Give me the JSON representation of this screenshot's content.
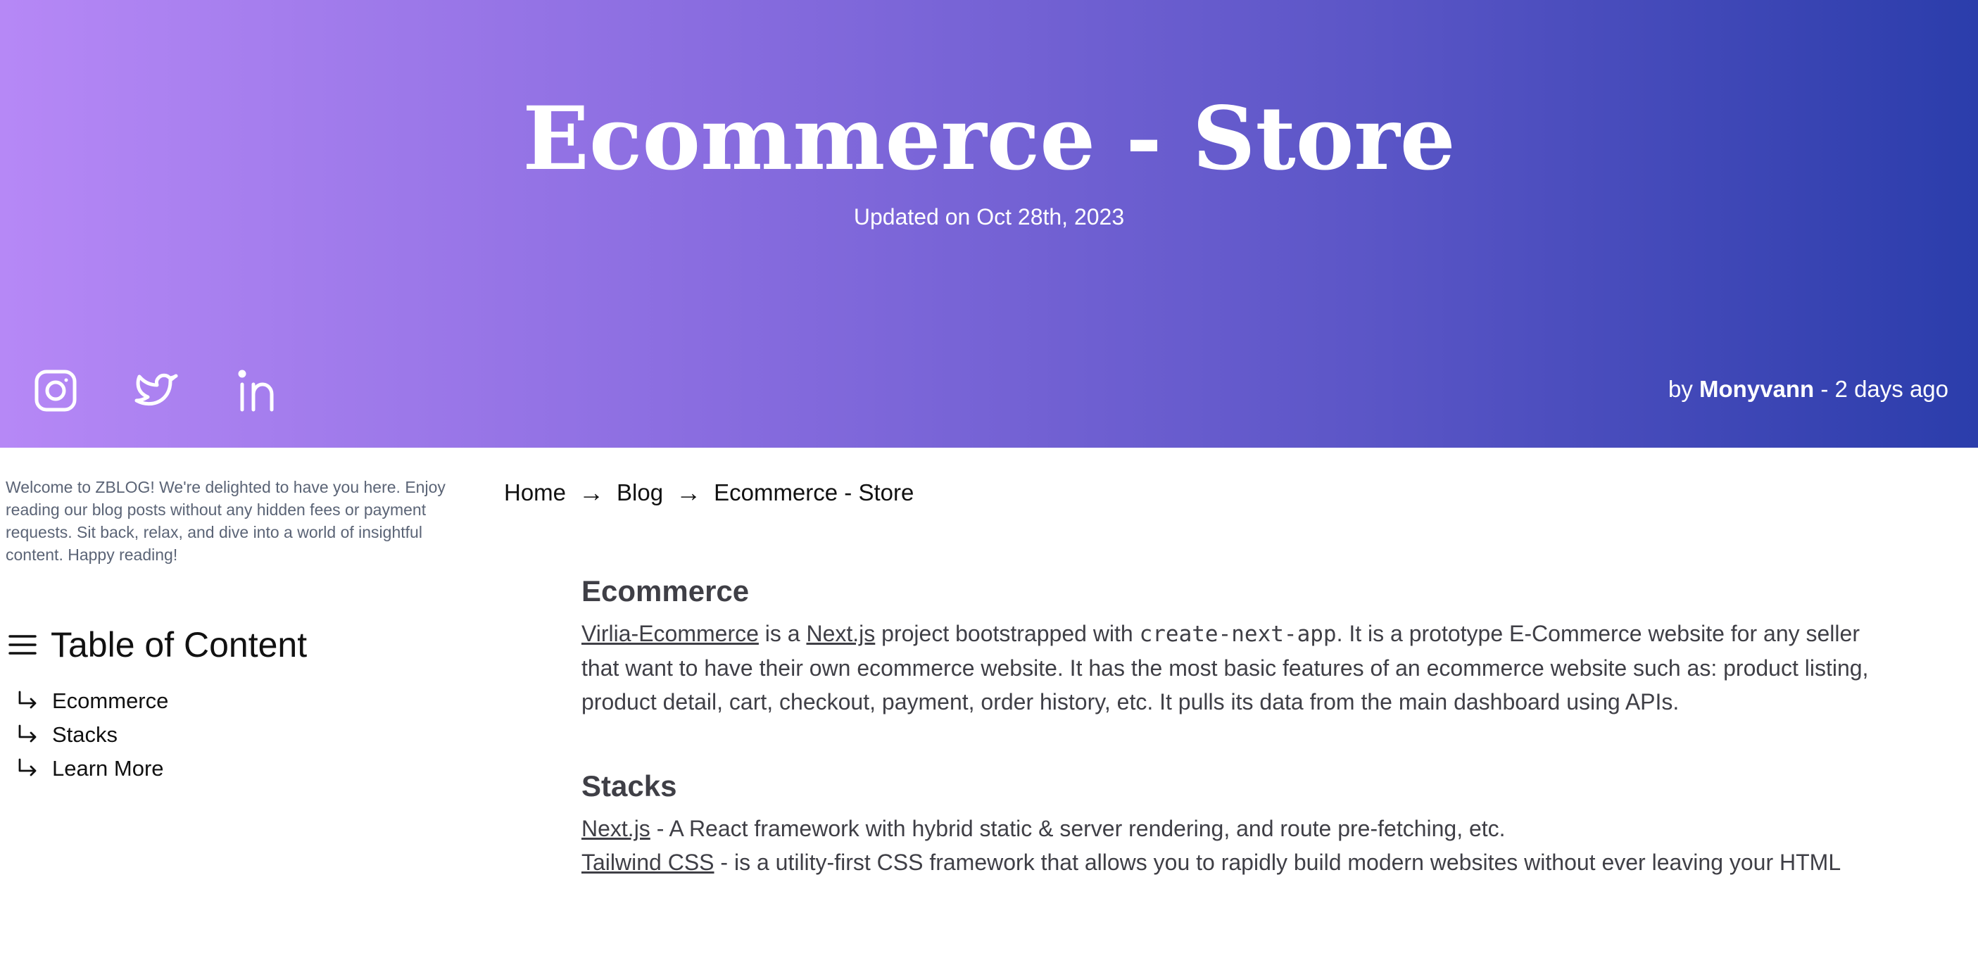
{
  "hero": {
    "title": "Ecommerce - Store",
    "updated": "Updated on Oct 28th, 2023",
    "social": [
      "instagram-icon",
      "twitter-icon",
      "linkedin-icon"
    ],
    "byline_prefix": "by ",
    "author": "Monyvann",
    "byline_suffix": " - 2 days ago",
    "gradient": [
      "#b688f6",
      "#2b3dab"
    ]
  },
  "sidebar": {
    "welcome": "Welcome to ZBLOG! We're delighted to have you here. Enjoy reading our blog posts without any hidden fees or payment requests. Sit back, relax, and dive into a world of insightful content. Happy reading!",
    "toc_title": "Table of Content",
    "toc_items": [
      "Ecommerce",
      "Stacks",
      "Learn More"
    ]
  },
  "breadcrumb": {
    "items": [
      "Home",
      "Blog",
      "Ecommerce - Store"
    ],
    "separator": "→"
  },
  "article": {
    "sections": [
      {
        "heading": "Ecommerce",
        "link1": "Virlia-Ecommerce",
        "text1": " is a ",
        "link2": "Next.js",
        "text2": " project bootstrapped with ",
        "code": "create-next-app",
        "text3": ". It is a prototype E-Commerce website for any seller that want to have their own ecommerce website. It has the most basic features of an ecommerce website such as: product listing, product detail, cart, checkout, payment, order history, etc. It pulls its data from the main dashboard using APIs."
      },
      {
        "heading": "Stacks",
        "lines": [
          {
            "link": "Next.js",
            "text": " - A React framework with hybrid static & server rendering, and route pre-fetching, etc."
          },
          {
            "link": "Tailwind CSS",
            "text": " - is a utility-first CSS framework that allows you to rapidly build modern websites without ever leaving your HTML"
          }
        ]
      }
    ]
  }
}
